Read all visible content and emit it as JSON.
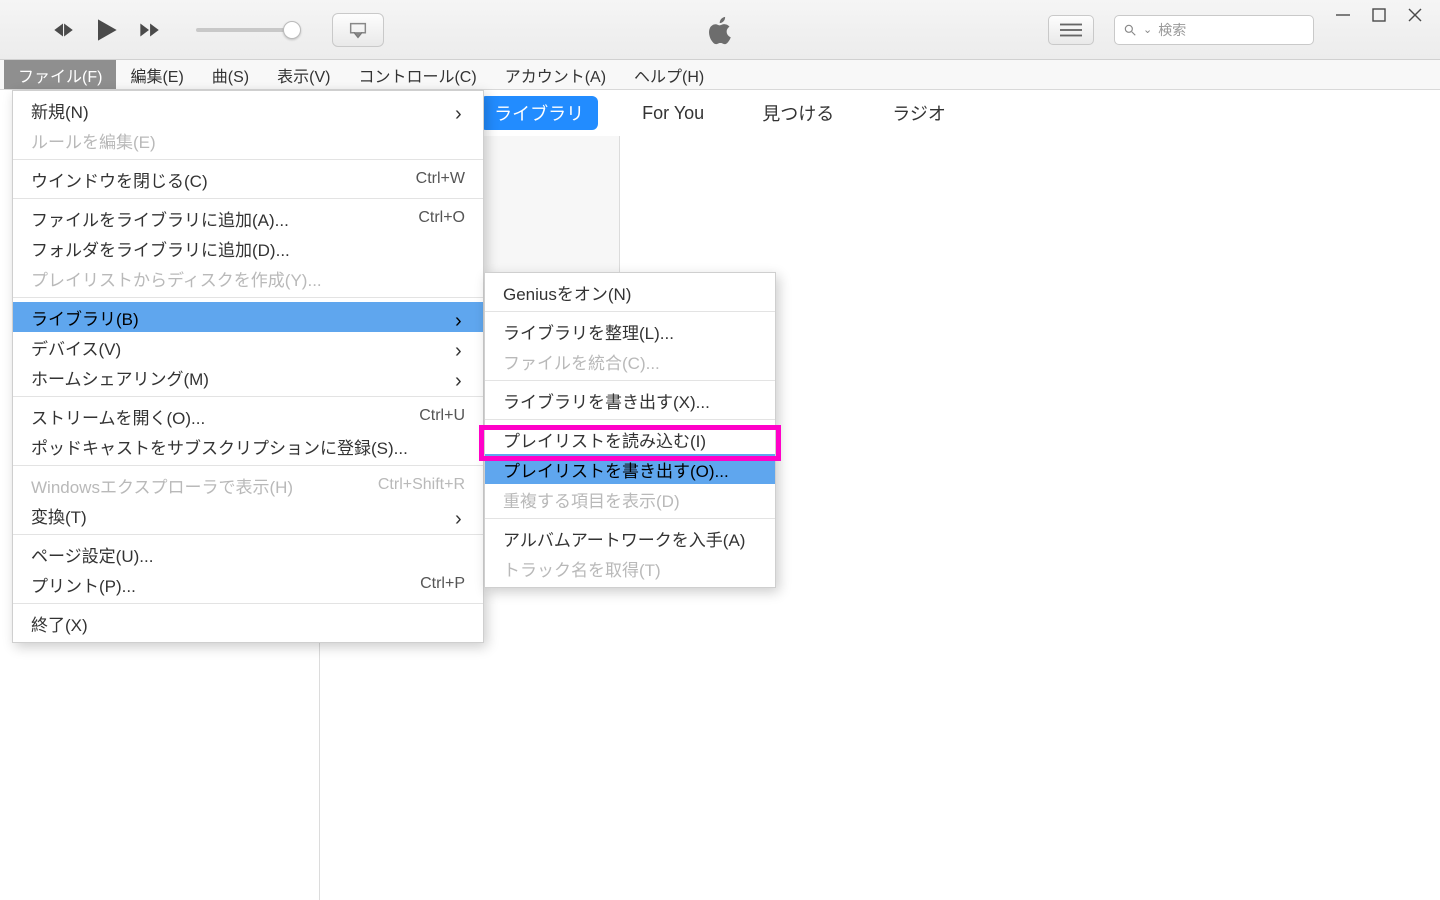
{
  "toolbar": {
    "search_placeholder": "検索"
  },
  "menubar": {
    "items": [
      "ファイル(F)",
      "編集(E)",
      "曲(S)",
      "表示(V)",
      "コントロール(C)",
      "アカウント(A)",
      "ヘルプ(H)"
    ]
  },
  "tabs": [
    "ライブラリ",
    "For You",
    "見つける",
    "ラジオ"
  ],
  "file_menu": [
    {
      "label": "新規(N)",
      "submenu": true
    },
    {
      "label": "ルールを編集(E)",
      "disabled": true
    },
    {
      "sep": true
    },
    {
      "label": "ウインドウを閉じる(C)",
      "shortcut": "Ctrl+W"
    },
    {
      "sep": true
    },
    {
      "label": "ファイルをライブラリに追加(A)...",
      "shortcut": "Ctrl+O"
    },
    {
      "label": "フォルダをライブラリに追加(D)..."
    },
    {
      "label": "プレイリストからディスクを作成(Y)...",
      "disabled": true
    },
    {
      "sep": true
    },
    {
      "label": "ライブラリ(B)",
      "submenu": true,
      "highlight": true
    },
    {
      "label": "デバイス(V)",
      "submenu": true
    },
    {
      "label": "ホームシェアリング(M)",
      "submenu": true
    },
    {
      "sep": true
    },
    {
      "label": "ストリームを開く(O)...",
      "shortcut": "Ctrl+U"
    },
    {
      "label": "ポッドキャストをサブスクリプションに登録(S)..."
    },
    {
      "sep": true
    },
    {
      "label": "Windowsエクスプローラで表示(H)",
      "shortcut": "Ctrl+Shift+R",
      "disabled": true
    },
    {
      "label": "変換(T)",
      "submenu": true
    },
    {
      "sep": true
    },
    {
      "label": "ページ設定(U)..."
    },
    {
      "label": "プリント(P)...",
      "shortcut": "Ctrl+P"
    },
    {
      "sep": true
    },
    {
      "label": "終了(X)"
    }
  ],
  "library_submenu": [
    {
      "label": "Geniusをオン(N)"
    },
    {
      "sep": true
    },
    {
      "label": "ライブラリを整理(L)..."
    },
    {
      "label": "ファイルを統合(C)...",
      "disabled": true
    },
    {
      "sep": true
    },
    {
      "label": "ライブラリを書き出す(X)..."
    },
    {
      "sep": true
    },
    {
      "label": "プレイリストを読み込む(I)"
    },
    {
      "label": "プレイリストを書き出す(O)...",
      "highlight": true
    },
    {
      "label": "重複する項目を表示(D)",
      "disabled": true
    },
    {
      "sep": true
    },
    {
      "label": "アルバムアートワークを入手(A)"
    },
    {
      "label": "トラック名を取得(T)",
      "disabled": true
    }
  ]
}
